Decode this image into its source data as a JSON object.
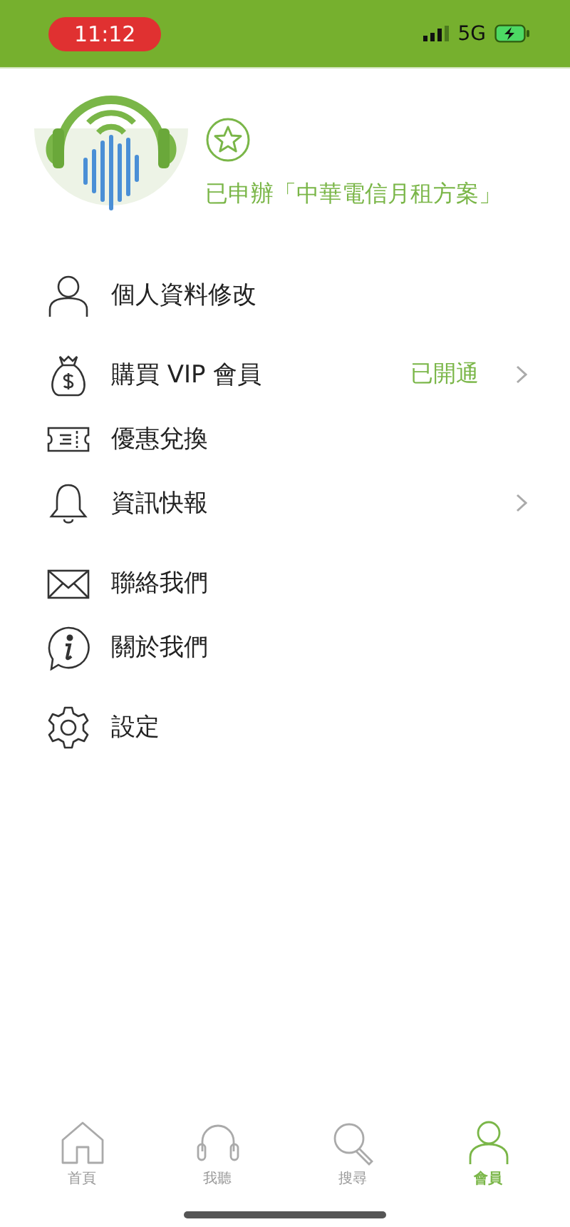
{
  "status_bar": {
    "time": "11:12",
    "network": "5G"
  },
  "profile": {
    "plan_text": "已申辦「中華電信月租方案」"
  },
  "menu_groups": [
    [
      {
        "label": "個人資料修改",
        "chevron": false
      }
    ],
    [
      {
        "label": "購買 VIP 會員",
        "status": "已開通",
        "chevron": true
      },
      {
        "label": "優惠兌換",
        "chevron": false
      },
      {
        "label": "資訊快報",
        "chevron": true
      }
    ],
    [
      {
        "label": "聯絡我們",
        "chevron": false
      },
      {
        "label": "關於我們",
        "chevron": false
      }
    ],
    [
      {
        "label": "設定",
        "chevron": false
      }
    ]
  ],
  "tab_bar": [
    {
      "label": "首頁",
      "selected": false
    },
    {
      "label": "我聽",
      "selected": false
    },
    {
      "label": "搜尋",
      "selected": false
    },
    {
      "label": "會員",
      "selected": true
    }
  ]
}
